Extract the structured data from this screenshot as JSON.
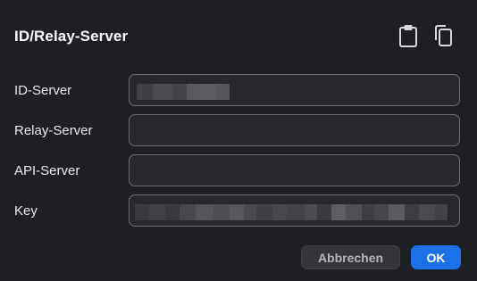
{
  "dialog": {
    "title": "ID/Relay-Server",
    "header_icons": [
      "clipboard-icon",
      "copy-icon"
    ]
  },
  "fields": [
    {
      "label": "ID-Server",
      "value": "",
      "redacted": true
    },
    {
      "label": "Relay-Server",
      "value": "",
      "redacted": false
    },
    {
      "label": "API-Server",
      "value": "",
      "redacted": false
    },
    {
      "label": "Key",
      "value": "",
      "redacted": true
    }
  ],
  "buttons": {
    "cancel_label": "Abbrechen",
    "ok_label": "OK"
  },
  "colors": {
    "background": "#1e1f24",
    "field_background": "#27282e",
    "field_border": "#6a6c73",
    "accent": "#1b72e8",
    "cancel_background": "#33353b"
  }
}
